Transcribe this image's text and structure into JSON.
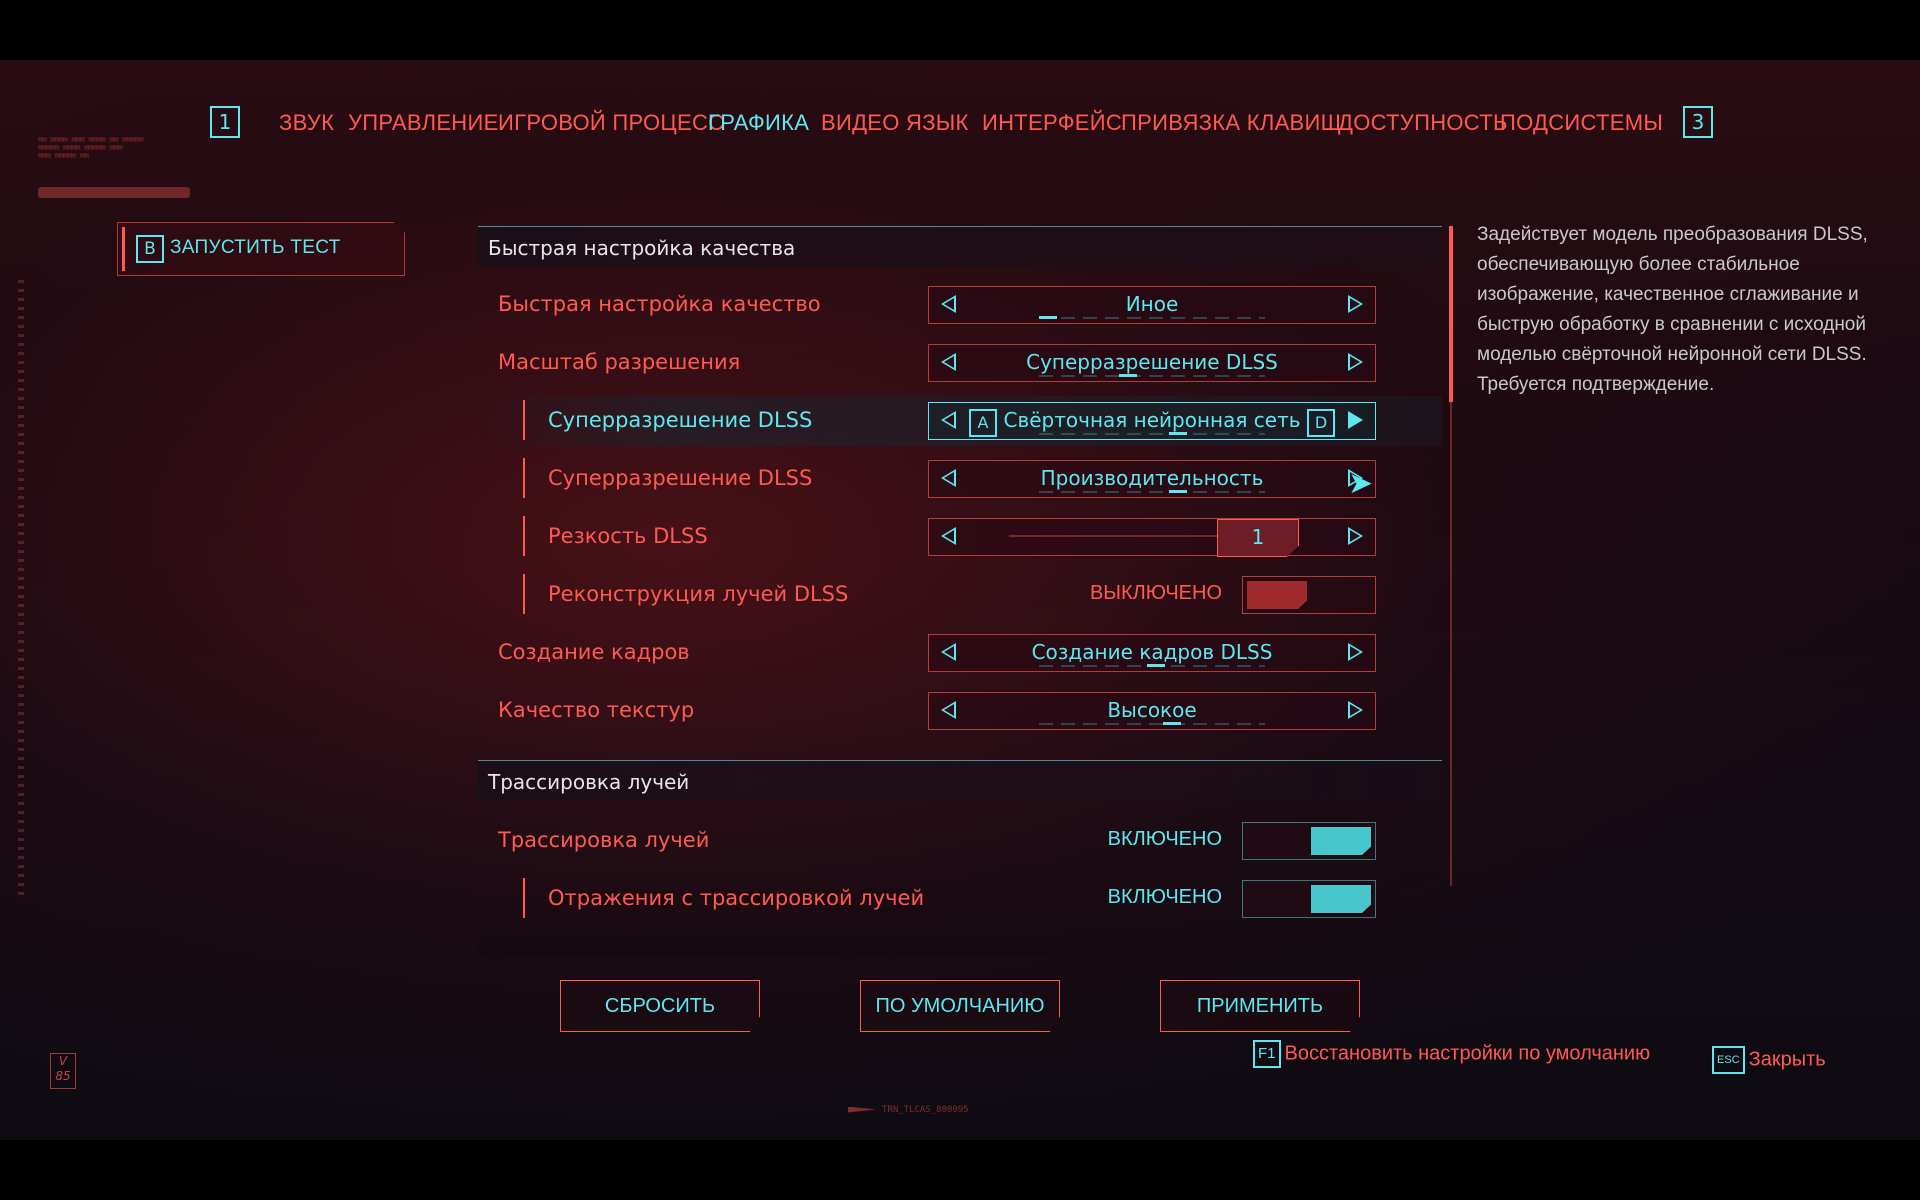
{
  "nav": {
    "left_key": "1",
    "right_key": "3",
    "tabs": [
      {
        "label": "ЗВУК",
        "active": false
      },
      {
        "label": "УПРАВЛЕНИЕ",
        "active": false
      },
      {
        "label": "ИГРОВОЙ ПРОЦЕСС",
        "active": false
      },
      {
        "label": "ГРАФИКА",
        "active": true
      },
      {
        "label": "ВИДЕО",
        "active": false
      },
      {
        "label": "ЯЗЫК",
        "active": false
      },
      {
        "label": "ИНТЕРФЕЙС",
        "active": false
      },
      {
        "label": "ПРИВЯЗКА КЛАВИШ",
        "active": false
      },
      {
        "label": "ДОСТУПНОСТЬ",
        "active": false
      },
      {
        "label": "ПОДСИСТЕМЫ",
        "active": false
      }
    ]
  },
  "run_test": {
    "key": "B",
    "label": "ЗАПУСТИТЬ ТЕСТ"
  },
  "sections": {
    "quick": {
      "title": "Быстрая настройка качества",
      "rows": {
        "preset": {
          "label": "Быстрая настройка качество",
          "value": "Иное"
        },
        "res_scale": {
          "label": "Масштаб разрешения",
          "value": "Суперразрешение DLSS"
        },
        "dlss_model": {
          "label": "Суперразрешение DLSS",
          "value": "Свёрточная нейронная сеть",
          "key_left": "A",
          "key_right": "D"
        },
        "dlss_mode": {
          "label": "Суперразрешение DLSS",
          "value": "Производительность"
        },
        "dlss_sharp": {
          "label": "Резкость DLSS",
          "value": "1",
          "slider_fraction": 1.0
        },
        "ray_recon": {
          "label": "Реконструкция лучей DLSS",
          "value": "ВЫКЛЮЧЕНО"
        },
        "frame_gen": {
          "label": "Создание кадров",
          "value": "Создание кадров DLSS"
        },
        "textures": {
          "label": "Качество текстур",
          "value": "Высокое"
        }
      }
    },
    "rt": {
      "title": "Трассировка лучей",
      "rows": {
        "rt_main": {
          "label": "Трассировка лучей",
          "value": "ВКЛЮЧЕНО"
        },
        "rt_refl": {
          "label": "Отражения с трассировкой лучей",
          "value": "ВКЛЮЧЕНО"
        }
      }
    }
  },
  "description": "Задействует модель преобразования DLSS, обеспечивающую более стабильное изображение, качественное сглаживание и быструю обработку в сравнении с исходной моделью свёрточной нейронной сети DLSS. Требуется подтверждение.",
  "buttons": {
    "reset": "СБРОСИТЬ",
    "default": "ПО УМОЛЧАНИЮ",
    "apply": "ПРИМЕНИТЬ"
  },
  "hints": {
    "restore": {
      "key": "F1",
      "label": "Восстановить настройки по умолчанию"
    },
    "close": {
      "key": "ESC",
      "label": "Закрыть"
    }
  },
  "version": "V 85",
  "build": "TRN_TLCAS_800095",
  "colors": {
    "accent_red": "#ff5a52",
    "accent_cyan": "#5ee7ee"
  }
}
